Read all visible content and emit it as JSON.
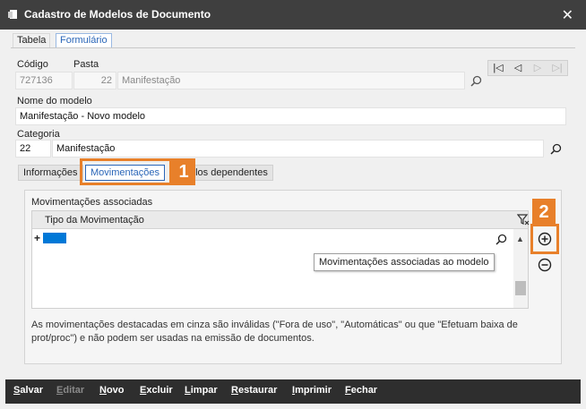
{
  "window": {
    "title": "Cadastro de Modelos de Documento",
    "close_symbol": "✕"
  },
  "tabs": [
    {
      "label": "Tabela",
      "active": false
    },
    {
      "label": "Formulário",
      "active": true
    }
  ],
  "form": {
    "codigo_label": "Código",
    "codigo_value": "727136",
    "pasta_label": "Pasta",
    "pasta_number": "22",
    "pasta_name": "Manifestação",
    "nome_label": "Nome do modelo",
    "nome_value": "Manifestação - Novo modelo",
    "categoria_label": "Categoria",
    "categoria_number": "22",
    "categoria_name": "Manifestação"
  },
  "record_nav": {
    "first": "|◁",
    "prev": "◁",
    "next": "▷",
    "last": "▷|"
  },
  "subtabs": [
    {
      "label": "Informações",
      "active": false
    },
    {
      "label": "Movimentações",
      "active": true
    },
    {
      "label": "Modelos dependentes",
      "active": false
    }
  ],
  "subtab_visible_text": {
    "informacoes": "Informações",
    "dependentes_partial": "elos dependentes"
  },
  "movimentacoes": {
    "group_label": "Movimentações associadas",
    "column_header": "Tipo da Movimentação",
    "new_row_marker": "+",
    "tooltip": "Movimentações associadas ao modelo",
    "note": "As movimentações destacadas em cinza são inválidas (\"Fora de uso\", \"Automáticas\" ou que \"Efetuam baixa de prot/proc\") e não podem ser usadas na emissão de documentos."
  },
  "callouts": {
    "badge1": "1",
    "badge2": "2",
    "color": "#e8802a"
  },
  "toolbar": {
    "salvar": {
      "first": "S",
      "rest": "alvar",
      "enabled": true
    },
    "editar": {
      "first": "E",
      "rest": "ditar",
      "enabled": false
    },
    "novo": {
      "first": "N",
      "rest": "ovo",
      "enabled": true
    },
    "excluir": {
      "first": "E",
      "rest": "xcluir",
      "enabled": true
    },
    "limpar": {
      "first": "L",
      "rest": "impar",
      "enabled": true
    },
    "restaurar": {
      "first": "R",
      "rest": "estaurar",
      "enabled": true
    },
    "imprimir": {
      "first": "I",
      "rest": "mprimir",
      "enabled": true
    },
    "fechar": {
      "first": "F",
      "rest": "echar",
      "enabled": true
    }
  },
  "icons": {
    "search": "search-icon",
    "add": "plus-circle-icon",
    "remove": "minus-circle-icon",
    "filter": "filter-icon"
  },
  "colors": {
    "titlebar": "#3f3f3f",
    "accent": "#2a66b8",
    "selection": "#0078d7",
    "callout": "#e8802a",
    "toolbar": "#2e2e2e"
  }
}
